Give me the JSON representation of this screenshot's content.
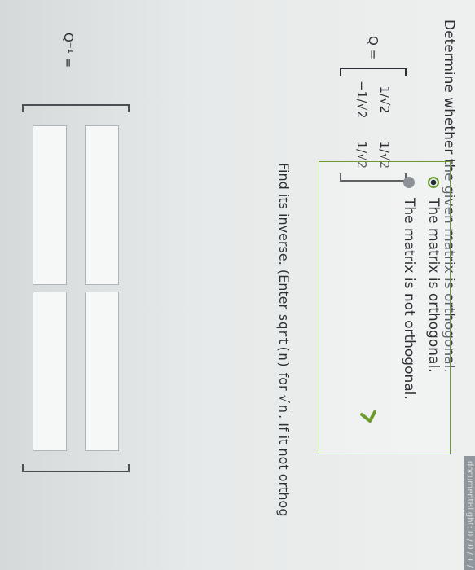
{
  "header": {
    "strip_text": "documentBlight: 0 / 0 / 1 / 2"
  },
  "question": {
    "text": "Determine whether the given matrix is orthogonal."
  },
  "matrix": {
    "label": "Q =",
    "rows": [
      [
        "1/√2",
        "1/√2"
      ],
      [
        "−1/√2",
        "1/√2"
      ]
    ]
  },
  "options": [
    {
      "label": "The matrix is orthogonal.",
      "selected": true
    },
    {
      "label": "The matrix is not orthogonal.",
      "selected": false
    }
  ],
  "feedback": {
    "icon": "checkmark-icon",
    "color": "#6c9a2d"
  },
  "instruction": {
    "prefix": "Find its inverse. (Enter ",
    "code": "sqrt(n)",
    "for_word": " for ",
    "sqrt_radicand": "n",
    "suffix": ". If it not orthog"
  },
  "inverse": {
    "label": "Q⁻¹ =",
    "cells": [
      "",
      "",
      "",
      ""
    ]
  }
}
